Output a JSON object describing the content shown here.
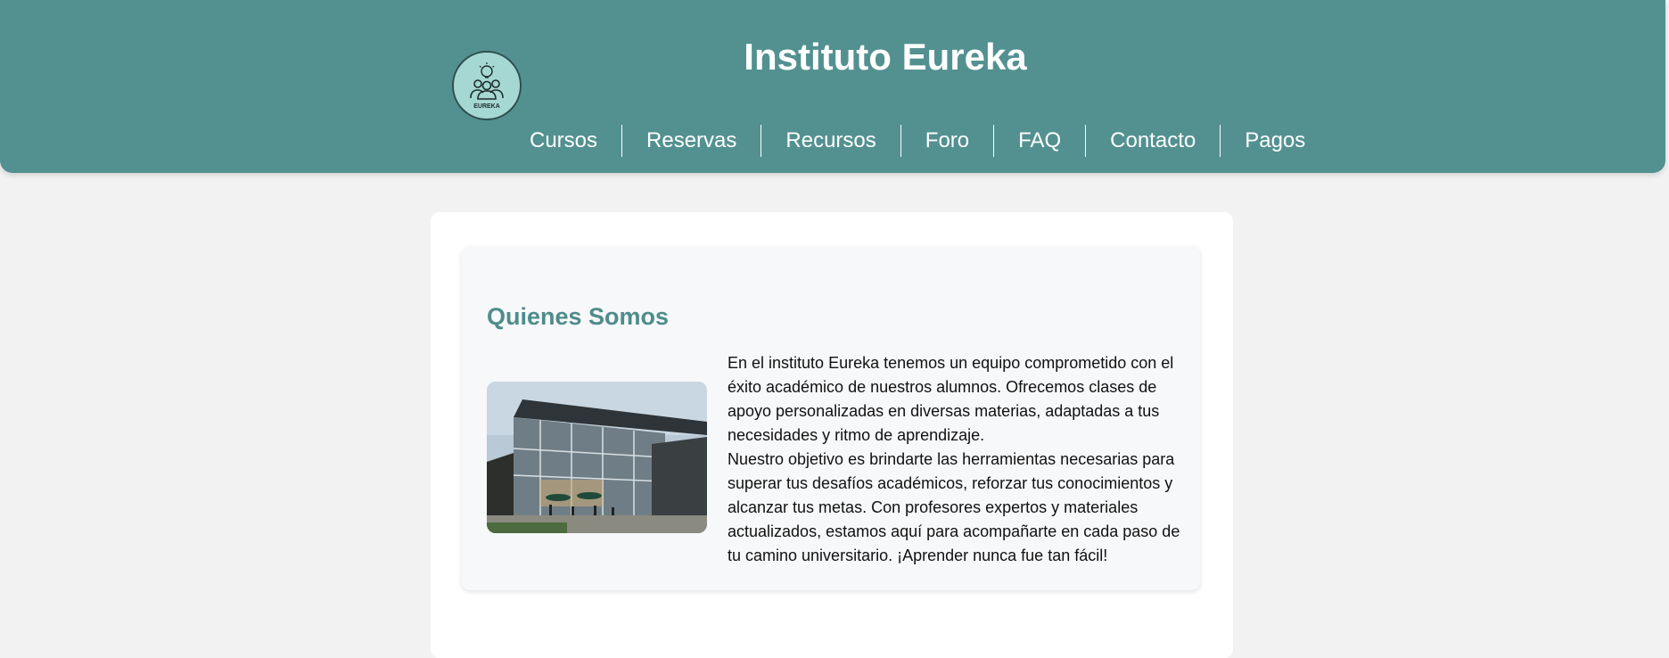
{
  "header": {
    "title": "Instituto Eureka",
    "logo_text": "EUREKA",
    "nav": [
      {
        "label": "Cursos"
      },
      {
        "label": "Reservas"
      },
      {
        "label": "Recursos"
      },
      {
        "label": "Foro"
      },
      {
        "label": "FAQ"
      },
      {
        "label": "Contacto"
      },
      {
        "label": "Pagos"
      }
    ]
  },
  "about": {
    "title": "Quienes Somos",
    "image_icon": "building-photo",
    "paragraphs": [
      "En el instituto Eureka tenemos un equipo comprometido con el éxito académico de nuestros alumnos. Ofrecemos clases de apoyo personalizadas en diversas materias, adaptadas a tus necesidades y ritmo de aprendizaje.",
      "Nuestro objetivo es brindarte las herramientas necesarias para superar tus desafíos académicos, reforzar tus conocimientos y alcanzar tus metas. Con profesores expertos y materiales actualizados, estamos aquí para acompañarte en cada paso de tu camino universitario. ¡Aprender nunca fue tan fácil!"
    ]
  },
  "colors": {
    "header_bg": "#539191",
    "accent": "#4f8c8c",
    "logo_bg": "#a6d8d3",
    "page_bg": "#f2f2f3"
  }
}
